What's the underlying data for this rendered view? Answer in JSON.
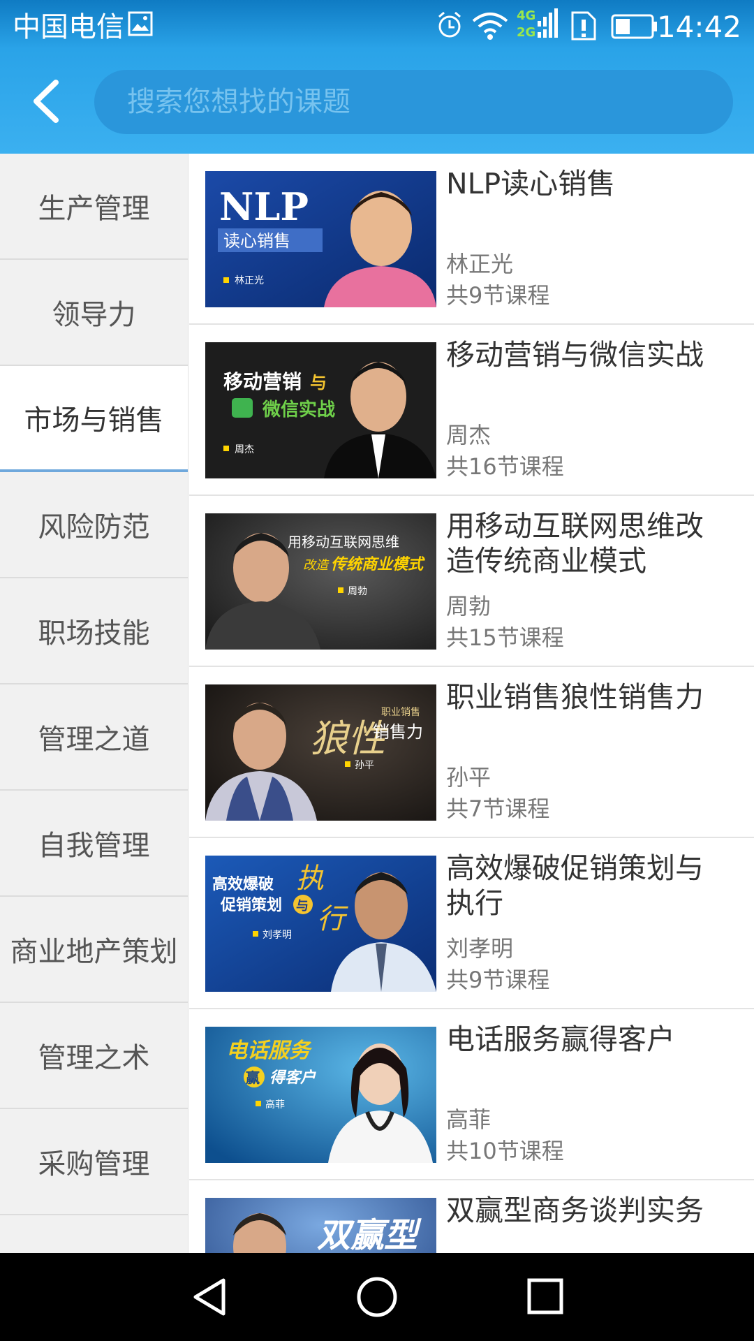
{
  "statusbar": {
    "carrier": "中国电信",
    "network_4g": "4G",
    "network_2g": "2G",
    "time": "14:42"
  },
  "search": {
    "placeholder": "搜索您想找的课题"
  },
  "colors": {
    "header_blue": "#3bb0f0",
    "search_bg": "#2a96db",
    "sidebar_bg": "#f1f1f1",
    "active_underline": "#6fa8dc"
  },
  "sidebar": {
    "items": [
      {
        "label": "生产管理",
        "active": false
      },
      {
        "label": "领导力",
        "active": false
      },
      {
        "label": "市场与销售",
        "active": true
      },
      {
        "label": "风险防范",
        "active": false
      },
      {
        "label": "职场技能",
        "active": false
      },
      {
        "label": "管理之道",
        "active": false
      },
      {
        "label": "自我管理",
        "active": false
      },
      {
        "label": "商业地产策划",
        "active": false
      },
      {
        "label": "管理之术",
        "active": false
      },
      {
        "label": "采购管理",
        "active": false
      }
    ]
  },
  "courses": [
    {
      "title": "NLP读心销售",
      "teacher": "林正光",
      "count": "共9节课程",
      "thumb": {
        "line1": "NLP",
        "line2": "读心销售",
        "name": "林正光"
      }
    },
    {
      "title": "移动营销与微信实战",
      "teacher": "周杰",
      "count": "共16节课程",
      "thumb": {
        "line1": "移动营销",
        "amp": "与",
        "line2": "微信实战",
        "name": "周杰"
      }
    },
    {
      "title": "用移动互联网思维改造传统商业模式",
      "teacher": "周勃",
      "count": "共15节课程",
      "thumb": {
        "line1": "用移动互联网思维",
        "line2a": "改造",
        "line2b": "传统商业模式",
        "name": "周勃"
      }
    },
    {
      "title": "职业销售狼性销售力",
      "teacher": "孙平",
      "count": "共7节课程",
      "thumb": {
        "line1": "狼性",
        "line2": "职业销售",
        "line3": "销售力",
        "name": "孙平"
      }
    },
    {
      "title": "高效爆破促销策划与执行",
      "teacher": "刘孝明",
      "count": "共9节课程",
      "thumb": {
        "line1": "高效爆破",
        "line2": "促销策划",
        "amp": "与",
        "big1": "执",
        "big2": "行",
        "name": "刘孝明"
      }
    },
    {
      "title": "电话服务赢得客户",
      "teacher": "高菲",
      "count": "共10节课程",
      "thumb": {
        "line1": "电话服务",
        "win": "赢",
        "line2": "得客户",
        "name": "高菲"
      }
    },
    {
      "title": "双赢型商务谈判实务",
      "teacher": "",
      "count": "",
      "thumb": {
        "line1": "双赢型"
      }
    }
  ]
}
